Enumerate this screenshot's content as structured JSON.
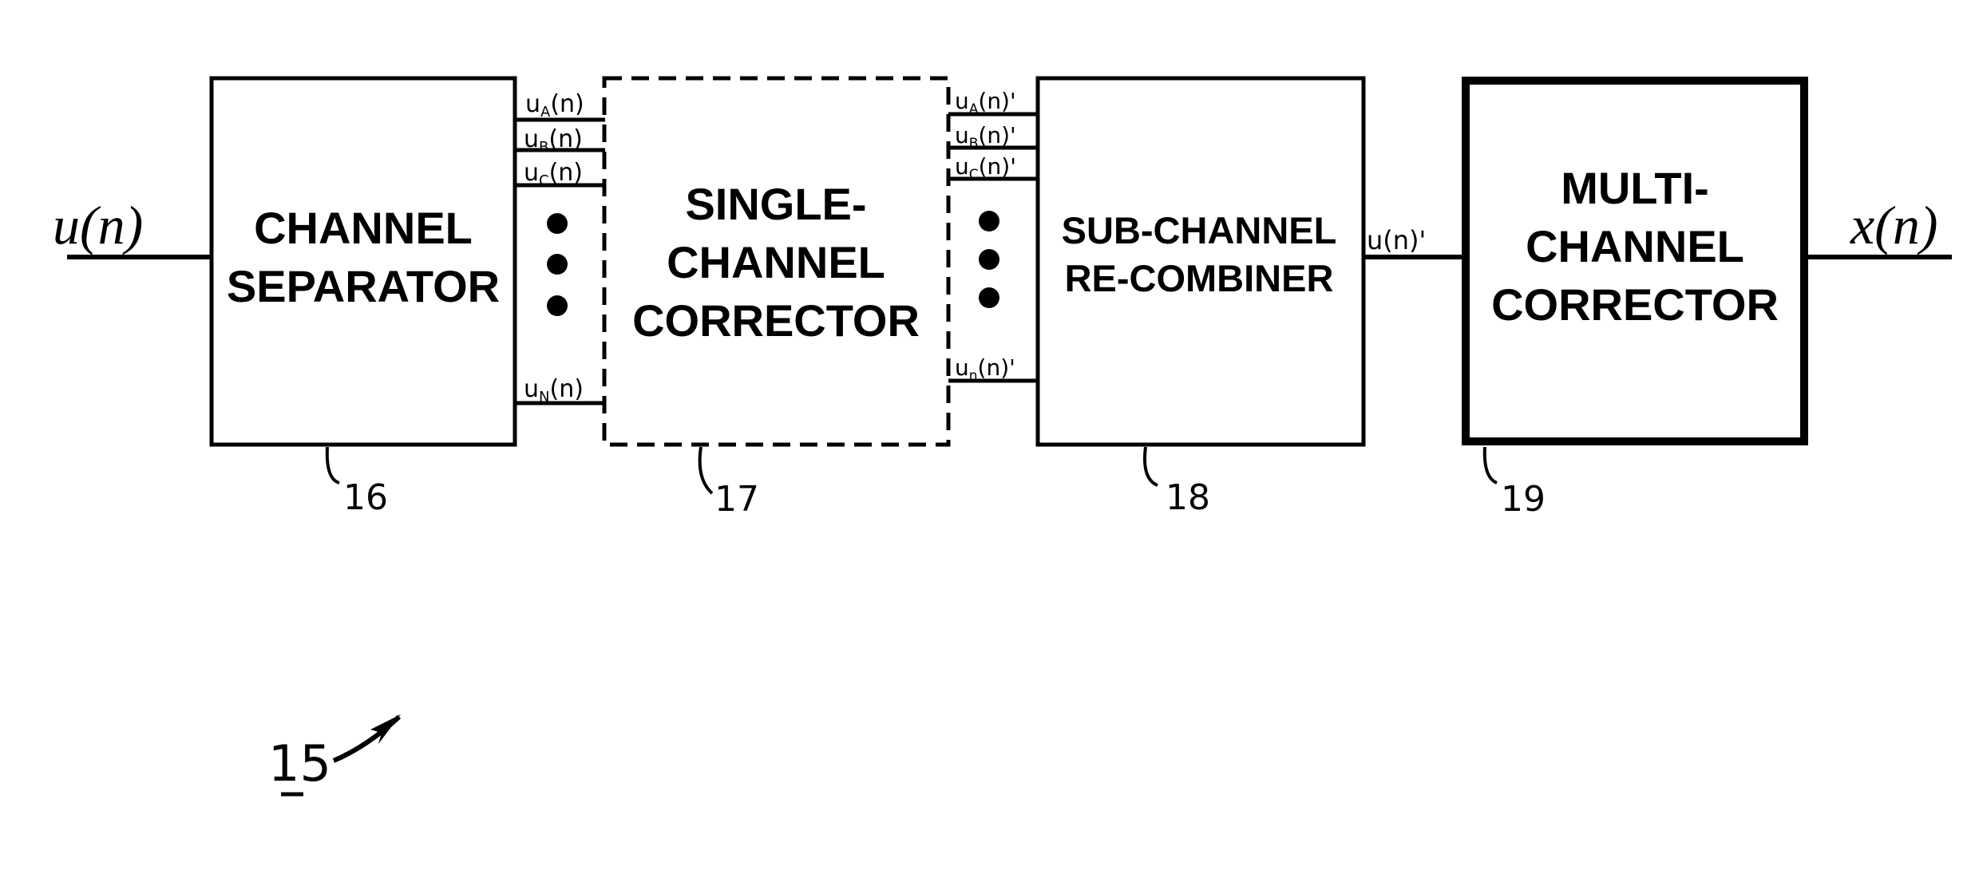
{
  "figure": {
    "label": "15",
    "input_signal": "u(n)",
    "output_signal": "x(n)",
    "blocks": [
      {
        "id": "channel-separator",
        "lines": [
          "CHANNEL",
          "SEPARATOR"
        ],
        "ref": "16",
        "style": "solid"
      },
      {
        "id": "single-channel-corrector",
        "lines": [
          "SINGLE-",
          "CHANNEL",
          "CORRECTOR"
        ],
        "ref": "17",
        "style": "dashed"
      },
      {
        "id": "sub-channel-recombiner",
        "lines": [
          "SUB-CHANNEL",
          "RE-COMBINER"
        ],
        "ref": "18",
        "style": "solid"
      },
      {
        "id": "multi-channel-corrector",
        "lines": [
          "MULTI-",
          "CHANNEL",
          "CORRECTOR"
        ],
        "ref": "19",
        "style": "bold"
      }
    ],
    "subchannels_in": [
      {
        "base": "u",
        "sub": "A",
        "suffix": "(n)"
      },
      {
        "base": "u",
        "sub": "B",
        "suffix": "(n)"
      },
      {
        "base": "u",
        "sub": "C",
        "suffix": "(n)"
      },
      {
        "base": "u",
        "sub": "N",
        "suffix": "(n)"
      }
    ],
    "subchannels_out": [
      {
        "base": "u",
        "sub": "A",
        "suffix": "(n)'"
      },
      {
        "base": "u",
        "sub": "B",
        "suffix": "(n)'"
      },
      {
        "base": "u",
        "sub": "C",
        "suffix": "(n)'"
      },
      {
        "base": "u",
        "sub": "n",
        "suffix": "(n)'"
      }
    ],
    "recombined_signal": "u(n)'",
    "ellipsis": "⋮"
  }
}
